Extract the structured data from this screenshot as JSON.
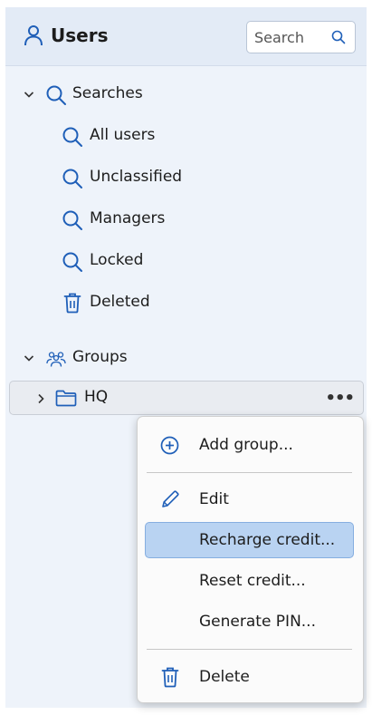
{
  "header": {
    "title": "Users",
    "icon": "user-icon",
    "search_placeholder": "Search"
  },
  "tree": {
    "searches": {
      "label": "Searches",
      "items": [
        {
          "label": "All users",
          "icon": "search-icon"
        },
        {
          "label": "Unclassified",
          "icon": "search-icon"
        },
        {
          "label": "Managers",
          "icon": "search-icon"
        },
        {
          "label": "Locked",
          "icon": "search-icon"
        },
        {
          "label": "Deleted",
          "icon": "trash-icon"
        }
      ]
    },
    "groups": {
      "label": "Groups",
      "items": [
        {
          "label": "HQ",
          "icon": "folder-icon",
          "expanded": false
        }
      ]
    }
  },
  "context_menu": {
    "items": [
      {
        "label": "Add group...",
        "icon": "plus-circle-icon"
      },
      {
        "label": "Edit",
        "icon": "pencil-icon"
      },
      {
        "label": "Recharge credit...",
        "selected": true
      },
      {
        "label": "Reset credit..."
      },
      {
        "label": "Generate PIN..."
      },
      {
        "label": "Delete",
        "icon": "trash-icon"
      }
    ]
  },
  "colors": {
    "panel_bg": "#eef3fa",
    "header_bg": "#e3ebf6",
    "accent_icon": "#1f5fb8",
    "selected_bg": "#b9d3f2"
  }
}
